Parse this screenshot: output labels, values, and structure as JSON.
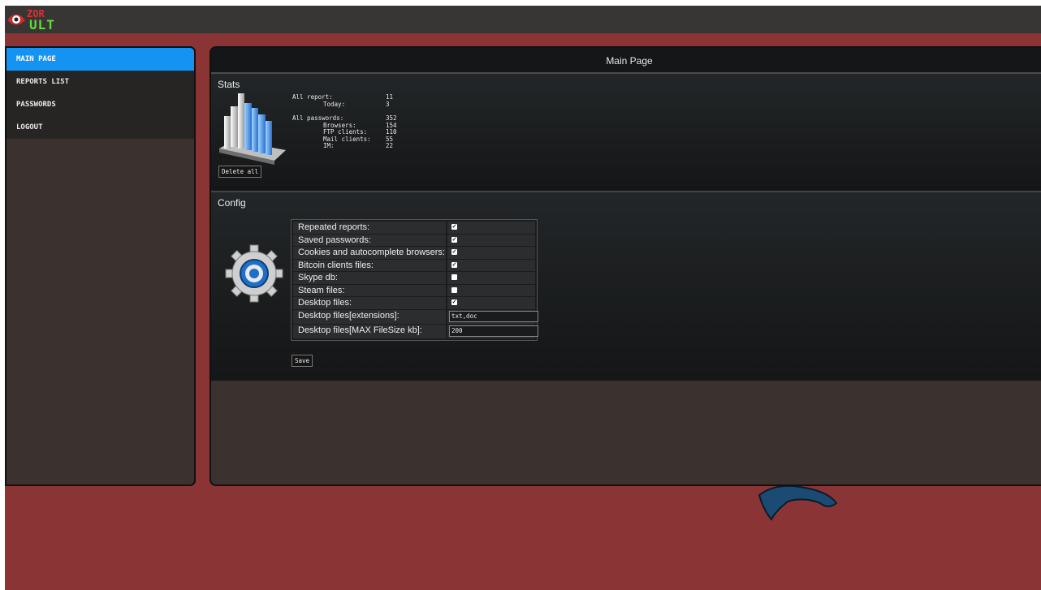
{
  "app": {
    "logo_top": "ZOR",
    "logo_bottom": "ULT"
  },
  "sidebar": {
    "items": [
      {
        "label": "MAIN PAGE"
      },
      {
        "label": "REPORTS LIST"
      },
      {
        "label": "PASSWORDS"
      },
      {
        "label": "LOGOUT"
      }
    ]
  },
  "main": {
    "title": "Main Page"
  },
  "stats": {
    "title": "Stats",
    "rows": [
      {
        "label": "All report:",
        "value": "11"
      },
      {
        "label": "       Today:",
        "value": "3"
      },
      {
        "label": "All passwords:",
        "value": "352"
      },
      {
        "label": "       Browsers:",
        "value": "154"
      },
      {
        "label": "       FTP clients:",
        "value": "110"
      },
      {
        "label": "       Mail clients:",
        "value": "55"
      },
      {
        "label": "       IM:",
        "value": "22"
      }
    ],
    "delete_label": "Delete all"
  },
  "config": {
    "title": "Config",
    "rows": [
      {
        "label": "Repeated reports:",
        "checked": true
      },
      {
        "label": "Saved passwords:",
        "checked": true
      },
      {
        "label": "Cookies and autocomplete browsers:",
        "checked": true
      },
      {
        "label": "Bitcoin clients files:",
        "checked": true
      },
      {
        "label": "Skype db:",
        "checked": false
      },
      {
        "label": "Steam files:",
        "checked": false
      },
      {
        "label": "Desktop files:",
        "checked": true
      }
    ],
    "ext_label": "Desktop files[extensions]:",
    "ext_value": "txt,doc",
    "size_label": "Desktop files[MAX FileSize kb]:",
    "size_value": "200",
    "save_label": "Save"
  },
  "colors": {
    "accent": "#1593f3",
    "background": "#8a3436",
    "panel": "#141617"
  },
  "icons": [
    "eye-logo-icon",
    "bar-chart-icon",
    "gear-icon",
    "eagle-mascot-icon"
  ]
}
